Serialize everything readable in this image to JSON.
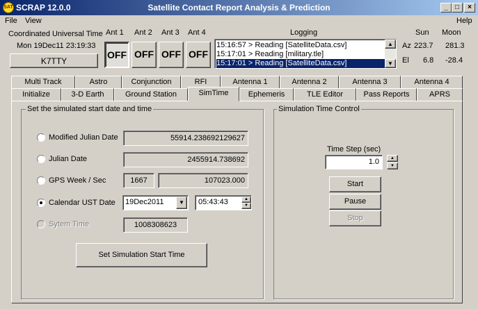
{
  "window": {
    "app_name": "SCRAP  12.0.0",
    "title": "Satellite Contact Report Analysis & Prediction",
    "icon_text": "SAT"
  },
  "menu": {
    "file": "File",
    "view": "View",
    "help": "Help"
  },
  "utc": {
    "label": "Coordinated Universal Time",
    "value": "Mon 19Dec11 23:19:33",
    "callsign": "K7TTY"
  },
  "antennas": [
    {
      "label": "Ant 1",
      "state": "OFF"
    },
    {
      "label": "Ant 2",
      "state": "OFF"
    },
    {
      "label": "Ant 3",
      "state": "OFF"
    },
    {
      "label": "Ant 4",
      "state": "OFF"
    }
  ],
  "logging": {
    "label": "Logging",
    "lines": [
      "15:16:57 > Reading [SatelliteData.csv]",
      "15:17:01 > Reading [military.tle]",
      "15:17:01 > Reading [SatelliteData.csv]"
    ]
  },
  "sunmoon": {
    "sun_label": "Sun",
    "moon_label": "Moon",
    "az_label": "Az",
    "el_label": "El",
    "sun_az": "223.7",
    "moon_az": "281.3",
    "sun_el": "6.8",
    "moon_el": "-28.4"
  },
  "tabs_row1": [
    "Multi Track",
    "Astro",
    "Conjunction",
    "RFI",
    "Antenna 1",
    "Antenna 2",
    "Antenna 3",
    "Antenna 4"
  ],
  "tabs_row2": [
    "Initialize",
    "3-D Earth",
    "Ground Station",
    "SimTime",
    "Ephemeris",
    "TLE Editor",
    "Pass Reports",
    "APRS"
  ],
  "sim_start": {
    "group_title": "Set the simulated start date and time",
    "mjd_label": "Modified Julian Date",
    "mjd_value": "55914.238692129627",
    "jd_label": "Julian Date",
    "jd_value": "2455914.738692",
    "gps_label": "GPS Week / Sec",
    "gps_week": "1667",
    "gps_sec": "107023.000",
    "cal_label": "Calendar UST Date",
    "cal_date": "19Dec2011",
    "cal_time": "05:43:43",
    "sys_label": "Sytem Time",
    "sys_value": "1008308623",
    "set_button": "Set Simulation Start Time"
  },
  "sim_control": {
    "group_title": "Simulation Time Control",
    "step_label": "Time Step (sec)",
    "step_value": "1.0",
    "start": "Start",
    "pause": "Pause",
    "stop": "Stop"
  }
}
